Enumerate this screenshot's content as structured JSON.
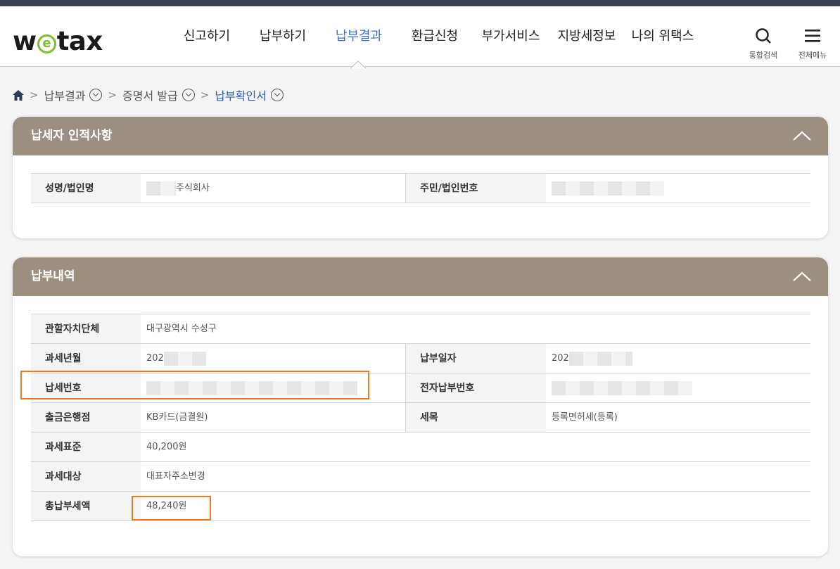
{
  "header": {
    "logo_prefix": "w",
    "logo_e": "e",
    "logo_suffix": "tax",
    "nav": [
      "신고하기",
      "납부하기",
      "납부결과",
      "환급신청",
      "부가서비스",
      "지방세정보",
      "나의 위택스"
    ],
    "active_nav": "납부결과",
    "search_label": "통합검색",
    "menu_label": "전체메뉴"
  },
  "breadcrumb": {
    "items": [
      "납부결과",
      "증명서 발급",
      "납부확인서"
    ]
  },
  "taxpayer": {
    "title": "납세자 인적사항",
    "name_label": "성명/법인명",
    "name_value": "주식회사",
    "id_label": "주민/법인번호"
  },
  "payment": {
    "title": "납부내역",
    "jurisdiction_label": "관할자치단체",
    "jurisdiction_value": "대구광역시 수성구",
    "tax_period_label": "과세년월",
    "tax_period_value": "202",
    "pay_date_label": "납부일자",
    "pay_date_value": "202",
    "tax_no_label": "납세번호",
    "epay_no_label": "전자납부번호",
    "bank_label": "출금은행점",
    "bank_value": "KB카드(금결원)",
    "tax_item_label": "세목",
    "tax_item_value": "등록면허세(등록)",
    "standard_label": "과세표준",
    "standard_value": "40,200원",
    "object_label": "과세대상",
    "object_value": "대표자주소변경",
    "total_label": "총납부세액",
    "total_value": "48,240원"
  },
  "colors": {
    "panel_header": "#9b9080",
    "active_nav": "#3a6fc0",
    "highlight": "#f0781e",
    "breadcrumb_current": "#2a5db0"
  }
}
